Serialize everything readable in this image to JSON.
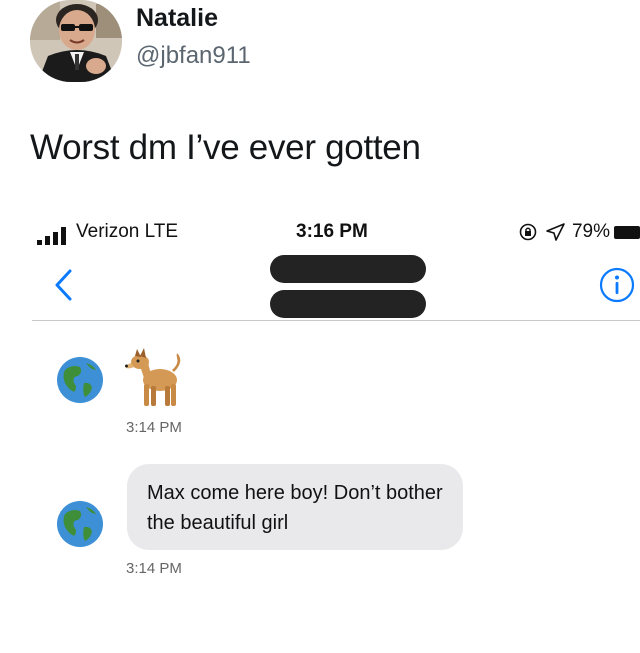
{
  "tweet": {
    "display_name": "Natalie",
    "handle": "@jbfan911",
    "text": "Worst dm I’ve ever gotten",
    "avatar_icon": "profile-photo"
  },
  "status_bar": {
    "carrier": "Verizon  LTE",
    "time": "3:16 PM",
    "battery": "79%",
    "icons": [
      "signal-bars-icon",
      "orientation-lock-icon",
      "location-arrow-icon",
      "battery-icon"
    ]
  },
  "nav": {
    "back_icon": "chevron-left-icon",
    "info_icon": "info-icon",
    "contact_name_redacted": true
  },
  "messages": [
    {
      "sender_avatar": "globe-emoji",
      "content_type": "emoji",
      "content": "dog-emoji",
      "time": "3:14 PM"
    },
    {
      "sender_avatar": "globe-emoji",
      "content_type": "text",
      "content": "Max come here boy! Don’t bother the beautiful girl",
      "time": "3:14 PM"
    }
  ],
  "colors": {
    "bubble": "#e9e9eb",
    "ios_blue": "#0a7aff",
    "redaction": "#232323"
  }
}
